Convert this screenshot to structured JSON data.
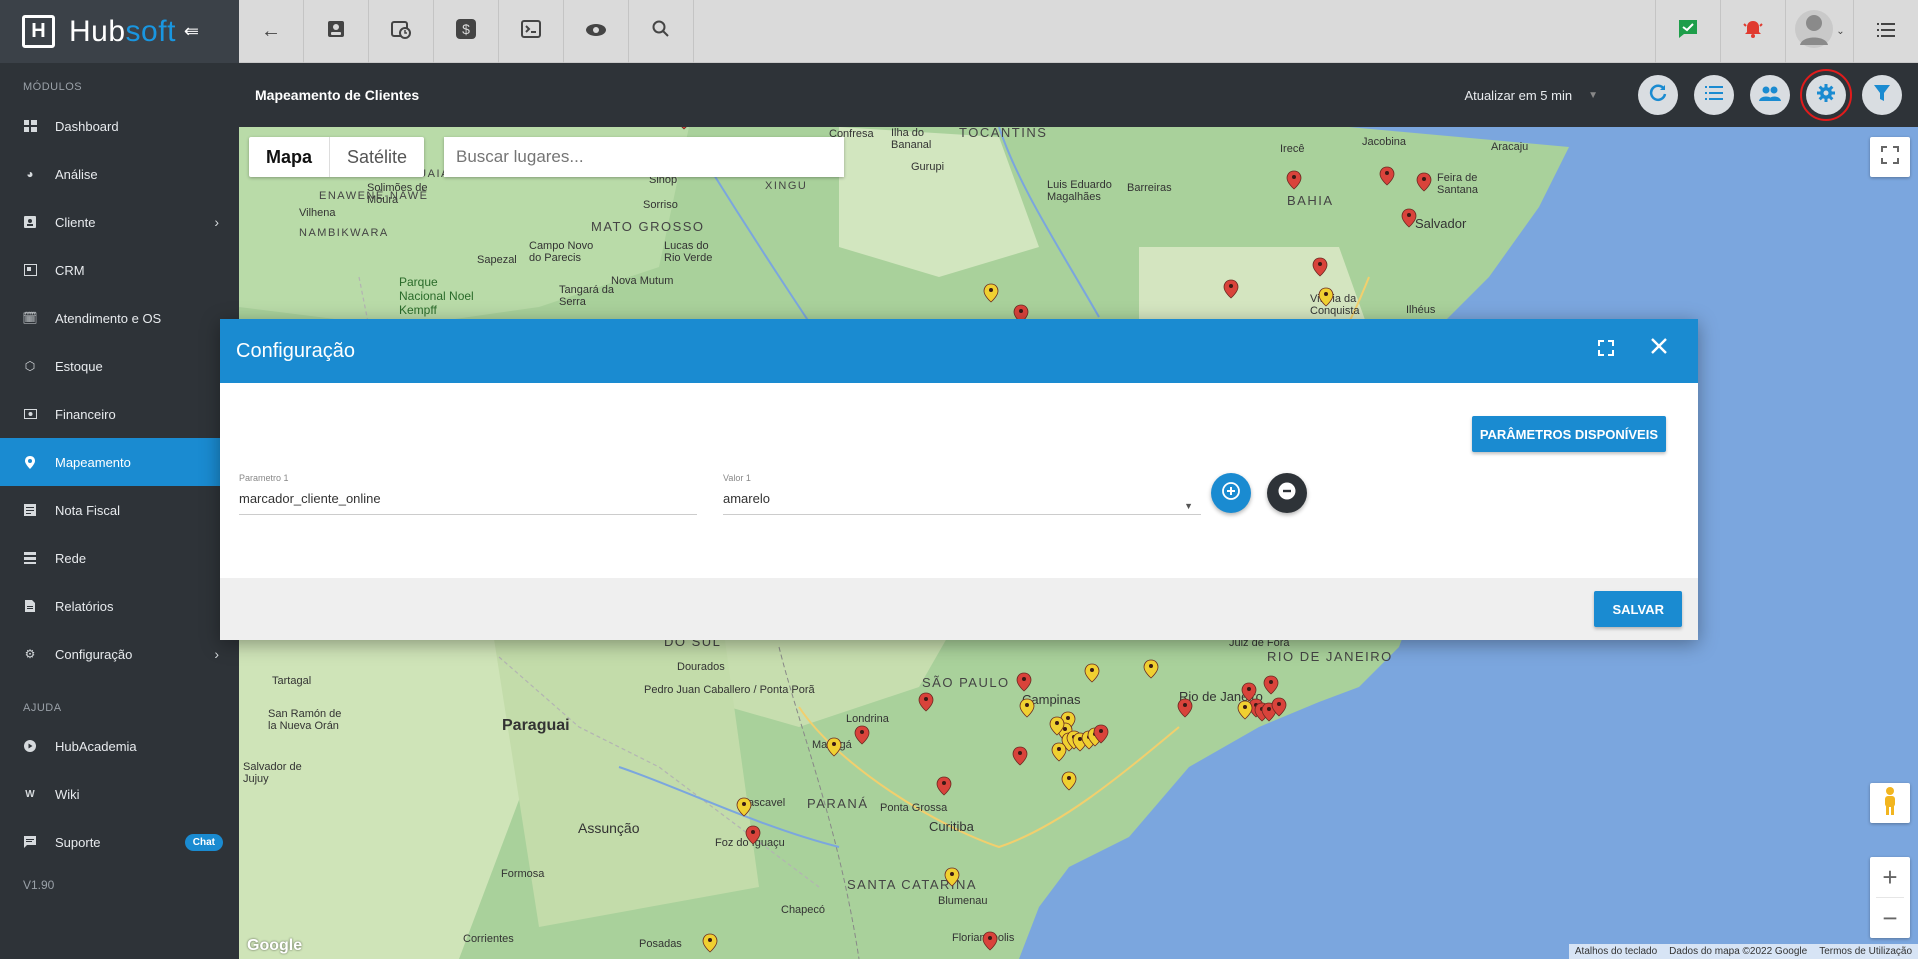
{
  "brand": {
    "name_a": "Hub",
    "name_b": "soft",
    "logo_letter": "H"
  },
  "sidebar": {
    "section_modules": "MÓDULOS",
    "items": [
      {
        "label": "Dashboard",
        "icon": "dashboard-icon"
      },
      {
        "label": "Análise",
        "icon": "pie-chart-icon"
      },
      {
        "label": "Cliente",
        "icon": "contact-card-icon"
      },
      {
        "label": "CRM",
        "icon": "crm-icon"
      },
      {
        "label": "Atendimento e OS",
        "icon": "calendar-clock-icon"
      },
      {
        "label": "Estoque",
        "icon": "box-icon"
      },
      {
        "label": "Financeiro",
        "icon": "money-icon"
      },
      {
        "label": "Mapeamento",
        "icon": "map-pin-icon"
      },
      {
        "label": "Nota Fiscal",
        "icon": "document-icon"
      },
      {
        "label": "Rede",
        "icon": "server-icon"
      },
      {
        "label": "Relatórios",
        "icon": "report-icon"
      },
      {
        "label": "Configuração",
        "icon": "gear-icon"
      }
    ],
    "section_help": "AJUDA",
    "help_items": [
      {
        "label": "HubAcademia",
        "icon": "play-icon"
      },
      {
        "label": "Wiki",
        "icon": "wiki-icon"
      },
      {
        "label": "Suporte",
        "icon": "chat-icon",
        "badge": "Chat"
      }
    ],
    "version": "V1.90"
  },
  "subheader": {
    "title": "Mapeamento de Clientes",
    "refresh_label": "Atualizar em 5 min"
  },
  "map": {
    "tab_map": "Mapa",
    "tab_satellite": "Satélite",
    "search_placeholder": "Buscar lugares...",
    "attribution": [
      "Atalhos do teclado",
      "Dados do mapa ©2022 Google",
      "Termos de Utilização"
    ],
    "google": "Google",
    "places": [
      {
        "name": "MATO GROSSO",
        "kind": "state"
      },
      {
        "name": "BAHIA",
        "kind": "state"
      },
      {
        "name": "TOCANTINS",
        "kind": "state"
      },
      {
        "name": "Paraguai",
        "kind": "big"
      },
      {
        "name": "SÃO PAULO",
        "kind": "state"
      },
      {
        "name": "PARANÁ",
        "kind": "state"
      },
      {
        "name": "SANTA CATARINA",
        "kind": "state"
      },
      {
        "name": "RIO DE JANEIRO",
        "kind": "state"
      },
      {
        "name": "Salvador",
        "kind": "city"
      },
      {
        "name": "Aracaju",
        "kind": "city"
      },
      {
        "name": "Assunção",
        "kind": "city"
      },
      {
        "name": "Curitiba",
        "kind": "city"
      },
      {
        "name": "Campinas",
        "kind": "city"
      },
      {
        "name": "Rio de Janeiro",
        "kind": "city"
      },
      {
        "name": "Londrina",
        "kind": "city"
      },
      {
        "name": "Maringá",
        "kind": "city"
      },
      {
        "name": "Dourados",
        "kind": "city"
      },
      {
        "name": "Ponta Grossa",
        "kind": "city"
      },
      {
        "name": "Blumenau",
        "kind": "city"
      },
      {
        "name": "Florianópolis",
        "kind": "city"
      },
      {
        "name": "Vitória da Conquista",
        "kind": "city"
      },
      {
        "name": "Feira de Santana",
        "kind": "city"
      },
      {
        "name": "Sorriso",
        "kind": "city"
      },
      {
        "name": "Sinop",
        "kind": "city"
      },
      {
        "name": "Vilhena",
        "kind": "city"
      },
      {
        "name": "Nova Mutum",
        "kind": "city"
      },
      {
        "name": "Chapecó",
        "kind": "city"
      },
      {
        "name": "Cascavel",
        "kind": "city"
      },
      {
        "name": "Juiz de Fora",
        "kind": "city"
      },
      {
        "name": "Luis Eduardo Magalhães",
        "kind": "city"
      },
      {
        "name": "Barreiras",
        "kind": "city"
      },
      {
        "name": "Irecê",
        "kind": "city"
      },
      {
        "name": "Jacobina",
        "kind": "city"
      },
      {
        "name": "Ilhéus",
        "kind": "city"
      },
      {
        "name": "Tangará da Serra",
        "kind": "city"
      },
      {
        "name": "Campo Novo do Parecis",
        "kind": "city"
      },
      {
        "name": "Sapezal",
        "kind": "city"
      },
      {
        "name": "Lucas do Rio Verde",
        "kind": "city"
      },
      {
        "name": "Parque Nacional Noel Kempff",
        "kind": "park"
      },
      {
        "name": "Gurupi",
        "kind": "city"
      },
      {
        "name": "Confresa",
        "kind": "city"
      },
      {
        "name": "Solimões de Moura",
        "kind": "city"
      },
      {
        "name": "Pedro Juan Caballero / Ponta Porã",
        "kind": "city"
      },
      {
        "name": "Foz do Iguaçu",
        "kind": "city"
      },
      {
        "name": "Posadas",
        "kind": "city"
      },
      {
        "name": "Corrientes",
        "kind": "city"
      },
      {
        "name": "Formosa",
        "kind": "city"
      },
      {
        "name": "Salvador de Jujuy",
        "kind": "city"
      },
      {
        "name": "Tartagal",
        "kind": "city"
      },
      {
        "name": "San Ramón de la Nueva Orán",
        "kind": "city"
      },
      {
        "name": "DO SUL",
        "kind": "state"
      },
      {
        "name": "ARAGUAIA",
        "kind": "park"
      },
      {
        "name": "XINGU",
        "kind": "park"
      },
      {
        "name": "NAMBIKWARA",
        "kind": "park"
      },
      {
        "name": "ENAWENÊ-NAWÊ",
        "kind": "park"
      },
      {
        "name": "Ilha do Bananal",
        "kind": "city"
      }
    ]
  },
  "modal": {
    "title": "Configuração",
    "params_button": "PARÂMETROS DISPONÍVEIS",
    "param_label": "Parametro 1",
    "param_value": "marcador_cliente_online",
    "value_label": "Valor 1",
    "value_value": "amarelo",
    "save_button": "SALVAR"
  },
  "colors": {
    "accent": "#1a8bd1",
    "sidebar_bg": "#2e3338",
    "marker_red": "#d9433b",
    "marker_yellow": "#f0d031",
    "highlight": "#e21b1b"
  }
}
